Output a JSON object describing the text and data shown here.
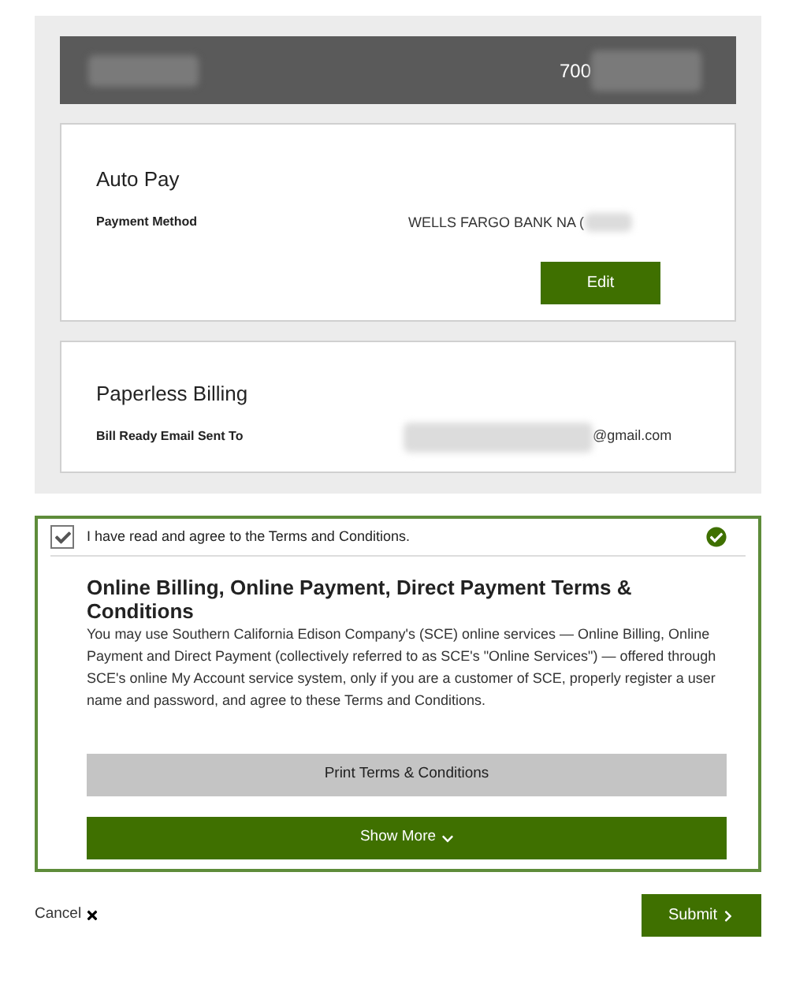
{
  "account_bar": {
    "number": "700"
  },
  "autopay": {
    "title": "Auto Pay",
    "label": "Payment Method",
    "value": "WELLS FARGO BANK NA (",
    "button": "Edit"
  },
  "paperless": {
    "title": "Paperless Billing",
    "label": "Bill Ready Email Sent To",
    "value": "@gmail.com"
  },
  "terms": {
    "agree_label": "I have read and agree to the Terms and Conditions.",
    "checked": true,
    "title": "Online Billing, Online Payment, Direct Payment Terms & Conditions",
    "body": "You may use Southern California Edison Company's (SCE) online services — Online Billing, Online Payment and Direct Payment (collectively referred to as SCE's \"Online Services\") — offered through SCE's online My Account service system, only if you are a customer of SCE, properly register a user name and password, and agree to these Terms and Conditions.",
    "print_button": "Print Terms & Conditions",
    "show_more_button": "Show More"
  },
  "actions": {
    "cancel": "Cancel",
    "submit": "Submit"
  }
}
